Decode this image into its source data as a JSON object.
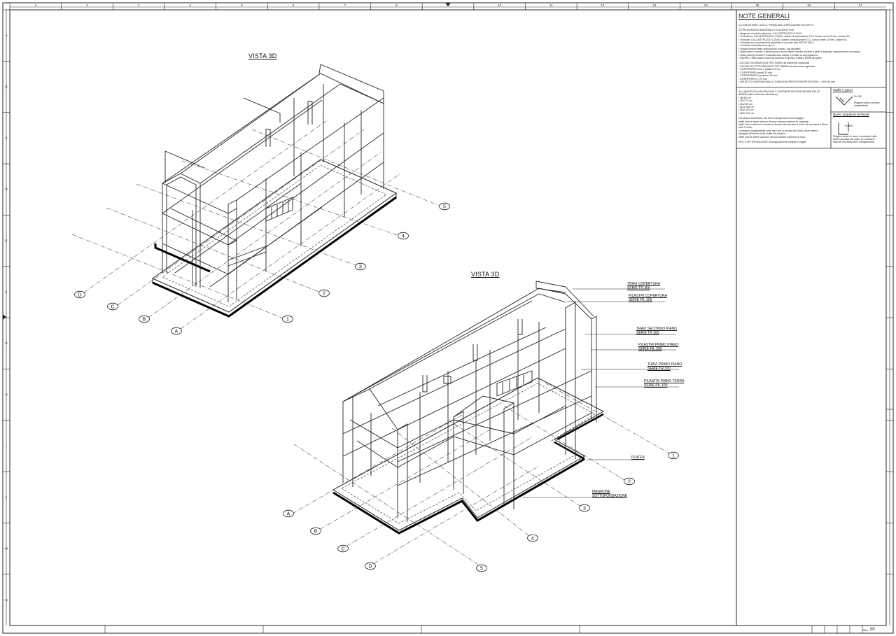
{
  "sheet": {
    "top_columns": [
      "1",
      "2",
      "3",
      "4",
      "5",
      "6",
      "7",
      "8",
      "9",
      "10",
      "11",
      "12",
      "13",
      "14",
      "15",
      "16",
      "17"
    ],
    "side_rows": [
      "A",
      "B",
      "C",
      "D",
      "E",
      "F",
      "G",
      "H",
      "I",
      "L",
      "M",
      "N"
    ],
    "rev_label": "Rev.",
    "rev_value": "00"
  },
  "views": [
    {
      "title": "VISTA 3D"
    },
    {
      "title": "VISTA 3D"
    }
  ],
  "view1_axes": {
    "letters": [
      "D",
      "C",
      "B",
      "A"
    ],
    "numbers": [
      "5",
      "4",
      "3",
      "2",
      "1"
    ]
  },
  "view2_axes": {
    "letters": [
      "A",
      "B",
      "C",
      "D"
    ],
    "numbers": [
      "1",
      "2",
      "3",
      "4",
      "5"
    ]
  },
  "legend": [
    {
      "l1": "TRAVI COPERTURA",
      "l2": "SERIE TR 300"
    },
    {
      "l1": "PILASTRI COPERTURA",
      "l2": "SERIE PIL 300"
    },
    {
      "l1": "TRAVI SECONDO PIANO",
      "l2": "SERIE TR 200"
    },
    {
      "l1": "PILASTRI PRIMO PIANO",
      "l2": "SERIE PIL 200"
    },
    {
      "l1": "TRAVI PRIMO PIANO",
      "l2": "SERIE TR 100"
    },
    {
      "l1": "PILASTRI PIANO TERRA",
      "l2": "SERIE PIL 100"
    },
    {
      "l1": "PLATEA",
      "l2": ""
    },
    {
      "l1": "MAGRONE",
      "l2": "SOTTOFONDAZIONE"
    }
  ],
  "notes": {
    "title": "NOTE GENERALI",
    "lines": [
      "1) CONTATTARE LA D.LL. PRIMA DELL'ESECUZIONE DEI GETTI",
      "",
      "2) PRESCRIZIONI MATERIALI E COSTRUTTIVE:",
      "• Magrone di sottofondazione: CALCESTRUZZO C12/15",
      "• Fondazioni: CALCESTRUZZO C25/30, classe di esposizione XC2, Dmax inerte 20 mm, classe S4,",
      "• Strutture:    CALCESTRUZZO C25/30, classe di esposizione XC1, Dmax inerte 20 mm, classe S4,",
      "• Calcestruzzo a prestazione garantita in accordo alla UNI EN 206-1",
      "• Controllo di accettazione tipo A",
      "• Durata minima della maturazione umida 7 gg dal getto",
      "• Nelle pareti e solette il calcestruzzo dovrà essere vibrato durante il getto e bagnato regolarmente con acqua",
      "• Nelle pareti prevedere il calcestruzzo adatto a evitare la segregazione",
      "• Riprese e interruzioni come da schema di ripresa, trattare prima del getto",
      "",
      "• ACCIAIO IN ARMATURA TIPO B450C ad aderenza migliorata",
      "• ACCIAIO ELETTROSALDATE TIPO B450A ad aderenza migliorata",
      "• COPRIFERRO travi e pilastri 25 mm",
      "• COPRIFERRO pareti 25 mm",
      "• COPRIFERRO fondazioni 40 mm",
      "• INTERFERRO > 20 mm",
      "• DISTACCO MASSIMO NELLE GIUNZIONI PER SOVRAPPOSIZIONE = 4Ø e 50 mm"
    ]
  },
  "lap_box": {
    "lines": [
      "3) LUNGHEZZA ANCORAGGIO E SOVRAPPOSIZIONE MINIMA DELLE",
      "BARRE (salvo diversa indicazione):",
      "• Ø8      60 cm",
      "• Ø10    70 cm",
      "• Ø12    80 cm",
      "• Ø14    100 cm",
      "• Ø16    110 cm",
      "• Ø20    120 cm",
      "",
      "Nei pilastri aumentare del 30% la lunghezza di ancoraggio,",
      "Nelle travi le barre inferiori devono essere continue in campata,",
      "Nelle travi continue le armature devono attraversare il nodo ed ancorarsi a 50cm",
      "oltre il nodo,",
      "L'armatura longitudinale nelle travi che si ancora nel nodo, deve essere",
      "ripiegata all'interno delle staffe del pilastro,",
      "Nelle travi le barre superiori devono essere continue al nodi,",
      "",
      "RETI ELETTROSALDATE: sovrapposizione minima 2 maglie"
    ]
  },
  "stirrup_box": {
    "title": "Staffe e ganci",
    "r_label": "R=2Ø",
    "note1": "Piegare contro la barra",
    "note2": "longitudinale"
  },
  "bend_box": {
    "title": "Barre: piegature terminali",
    "r_label": "R=6Ø",
    "note1": "Piegare contro le barre trasversali sulla",
    "note2": "faccia opposta del nodo, se mancanti",
    "note3": "inserire una barra Ø20 d'irrigidimento"
  }
}
